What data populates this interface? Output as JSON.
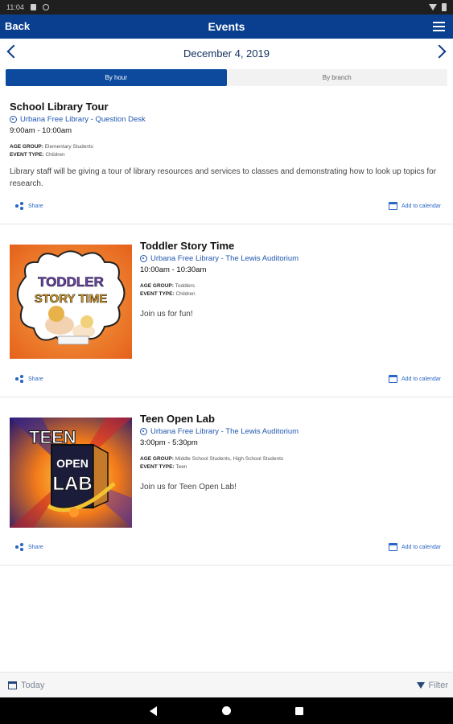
{
  "app_bar": {
    "back_label": "Back",
    "title": "Events",
    "menu_icon": "hamburger-menu-icon"
  },
  "date_nav": {
    "date": "December 4, 2019"
  },
  "tabs": [
    {
      "label": "By hour",
      "active": true
    },
    {
      "label": "By branch",
      "active": false
    }
  ],
  "events": [
    {
      "title": "School Library Tour",
      "location": "Urbana Free Library - Question Desk",
      "time": "9:00am - 10:00am",
      "age_group_label": "AGE GROUP:",
      "age_group": "Elementary Students",
      "event_type_label": "EVENT TYPE:",
      "event_type": "Children",
      "description": "Library staff will be giving a tour of library resources and services to classes and demonstrating how to look up topics for research.",
      "share_label": "Share",
      "calendar_label": "Add to calendar"
    },
    {
      "title": "Toddler Story Time",
      "location": "Urbana Free Library - The Lewis Auditorium",
      "time": "10:00am - 10:30am",
      "age_group_label": "AGE GROUP:",
      "age_group": "Toddlers",
      "event_type_label": "EVENT TYPE:",
      "event_type": "Children",
      "description": "Join us for fun!",
      "image_text_1": "TODDLER",
      "image_text_2": "STORY TIME",
      "share_label": "Share",
      "calendar_label": "Add to calendar"
    },
    {
      "title": "Teen Open Lab",
      "location": "Urbana Free Library - The Lewis Auditorium",
      "time": "3:00pm - 5:30pm",
      "age_group_label": "AGE GROUP:",
      "age_group": "Middle School Students, High School Students",
      "event_type_label": "EVENT TYPE:",
      "event_type": "Teen",
      "description": "Join us for Teen Open Lab!",
      "image_text_1": "TEEN",
      "image_text_2": "OPEN",
      "image_text_3": "LAB",
      "share_label": "Share",
      "calendar_label": "Add to calendar"
    }
  ],
  "bottom_bar": {
    "today_label": "Today",
    "filter_label": "Filter"
  },
  "colors": {
    "header": "#093f8e",
    "link": "#2a66c4",
    "active_tab": "#0d4a9e"
  }
}
